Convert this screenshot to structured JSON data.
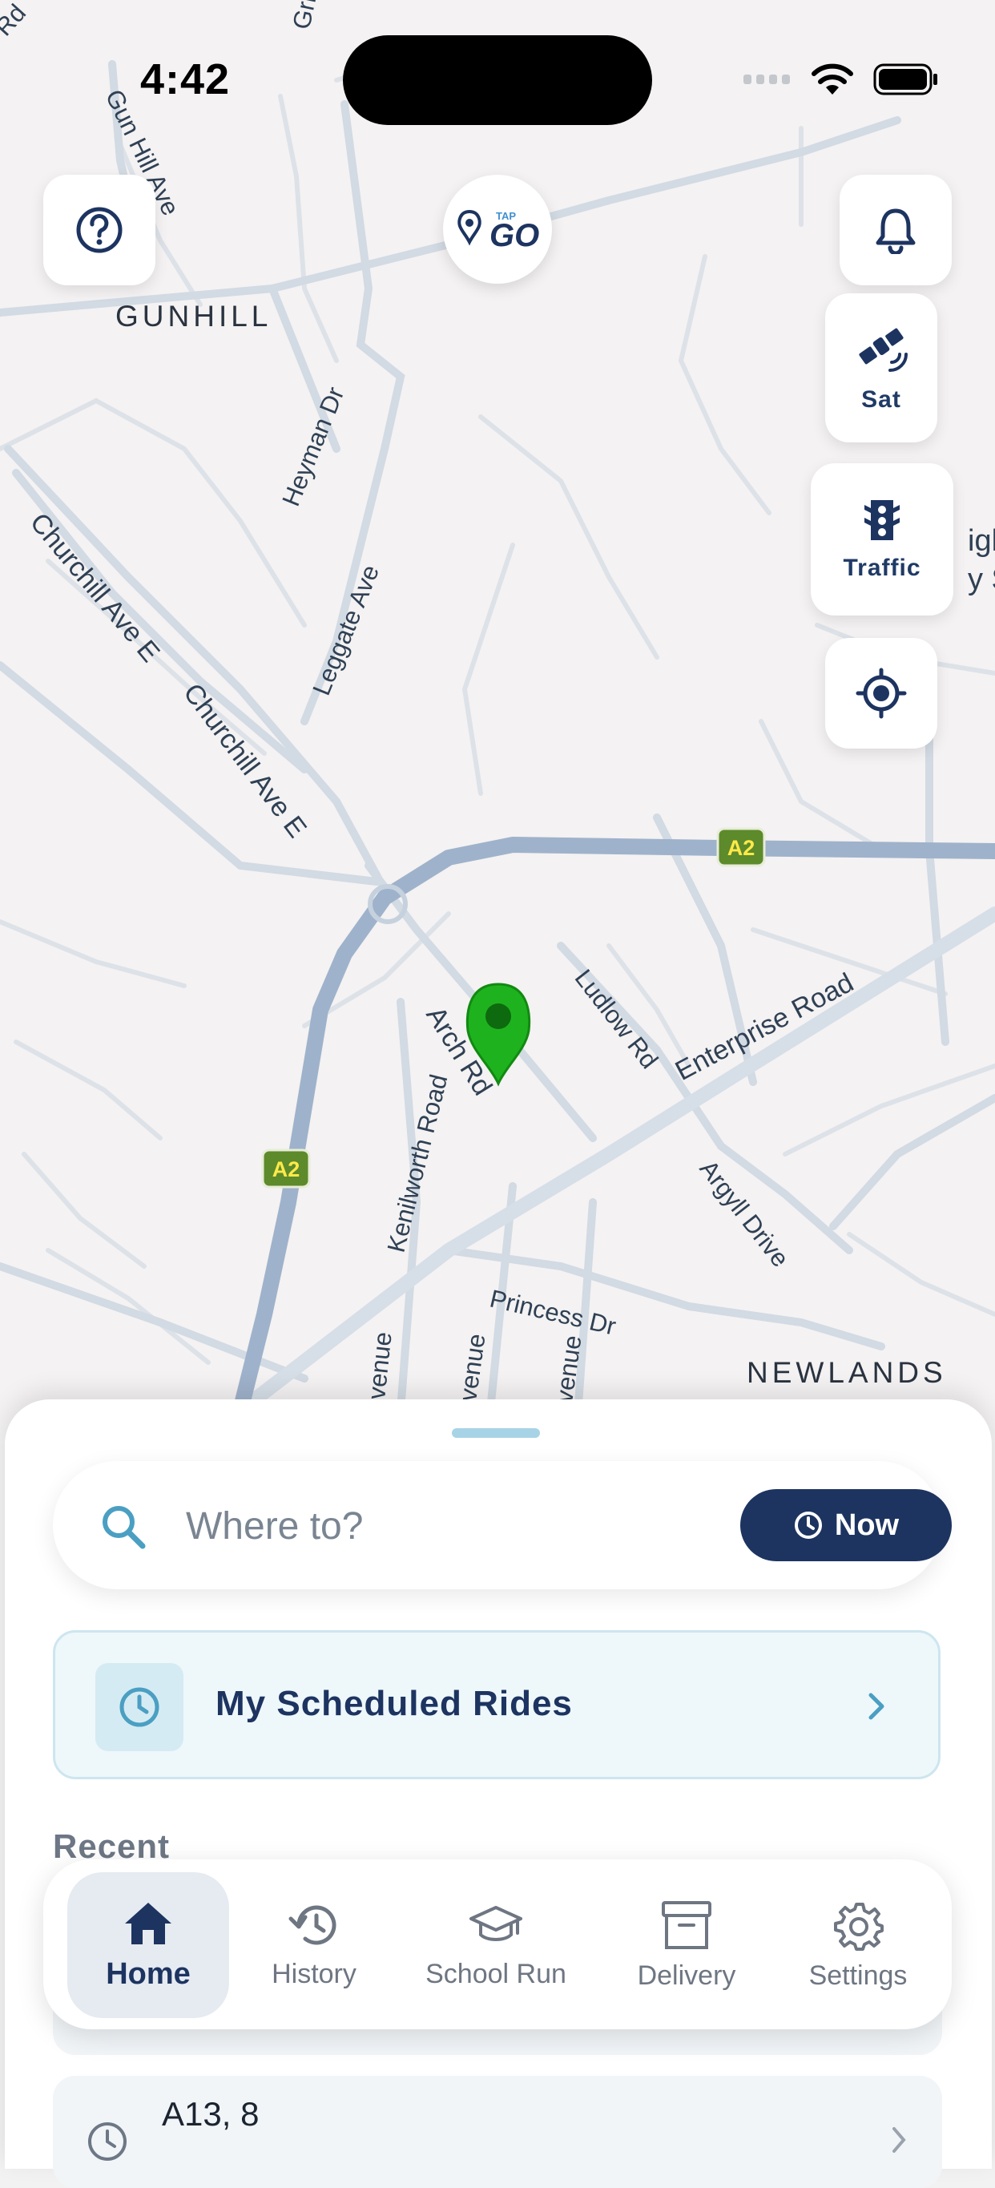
{
  "status_bar": {
    "time": "4:42"
  },
  "map": {
    "areas": [
      "GUNHILL",
      "NEWLANDS"
    ],
    "roads": [
      "Rd",
      "Gun Hill Ave",
      "Griffin Road",
      "Heyman Dr",
      "Churchill Ave E",
      "Churchill Ave E",
      "Leggate Ave",
      "Ludlow Rd",
      "Enterprise Road",
      "Arch Rd",
      "Kenilworth Road",
      "Argyll Drive",
      "Princess Dr",
      "venue",
      "venue",
      "venue",
      "igh",
      "y S"
    ],
    "route_shields": [
      "A2",
      "A2"
    ]
  },
  "controls": {
    "help_icon": "question-circle-icon",
    "bell_icon": "bell-icon",
    "satellite_label": "Sat",
    "traffic_label": "Traffic",
    "locate_icon": "crosshair-icon"
  },
  "logo": {
    "small": "TAP",
    "text": "GO"
  },
  "search": {
    "placeholder": "Where to?",
    "now_label": "Now"
  },
  "scheduled": {
    "label": "My Scheduled Rides"
  },
  "recent": {
    "title": "Recent",
    "items": [
      {
        "label": "A13, 8"
      }
    ]
  },
  "nav": {
    "items": [
      {
        "label": "Home",
        "icon": "home-icon",
        "active": true
      },
      {
        "label": "History",
        "icon": "history-icon"
      },
      {
        "label": "School Run",
        "icon": "graduation-cap-icon"
      },
      {
        "label": "Delivery",
        "icon": "archive-box-icon"
      },
      {
        "label": "Settings",
        "icon": "gear-icon"
      }
    ]
  },
  "colors": {
    "primary": "#1d3461",
    "accent": "#4a9fc2",
    "pin": "#1eb31e",
    "road_major": "#9fb2cb"
  }
}
